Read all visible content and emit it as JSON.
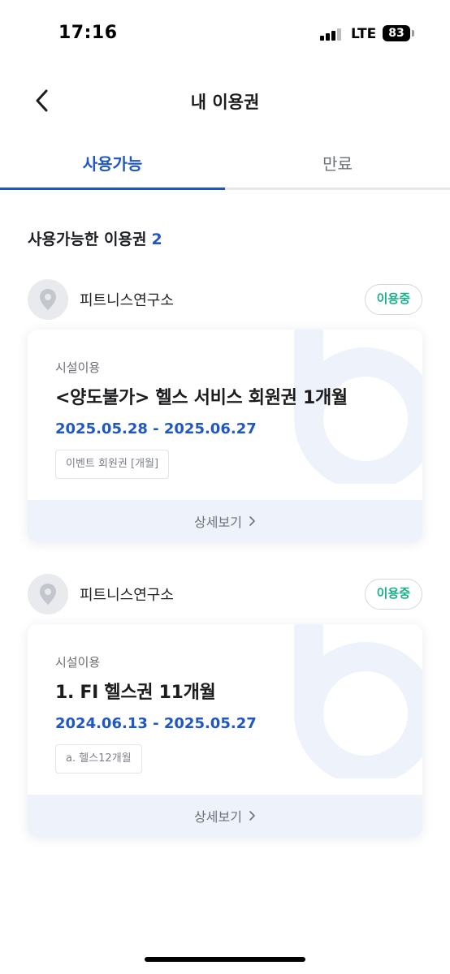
{
  "status_bar": {
    "time": "17:16",
    "network": "LTE",
    "battery": "83"
  },
  "header": {
    "back_icon": "chevron-left-icon",
    "title": "내 이용권"
  },
  "tabs": [
    {
      "label": "사용가능",
      "active": true
    },
    {
      "label": "만료",
      "active": false
    }
  ],
  "section": {
    "heading": "사용가능한 이용권",
    "count": "2"
  },
  "passes": [
    {
      "facility": "피트니스연구소",
      "status": "이용중",
      "category": "시설이용",
      "name": "<양도불가> 헬스 서비스 회원권 1개월",
      "period": "2025.05.28 - 2025.06.27",
      "tag": "이벤트 회원권 [개월]",
      "detail_label": "상세보기"
    },
    {
      "facility": "피트니스연구소",
      "status": "이용중",
      "category": "시설이용",
      "name": "1. FI 헬스권 11개월",
      "period": "2024.06.13 - 2025.05.27",
      "tag": "a. 헬스12개월",
      "detail_label": "상세보기"
    }
  ],
  "colors": {
    "accent": "#1f57c4",
    "status_green": "#18b088",
    "detail_bg": "#edf2fb"
  }
}
